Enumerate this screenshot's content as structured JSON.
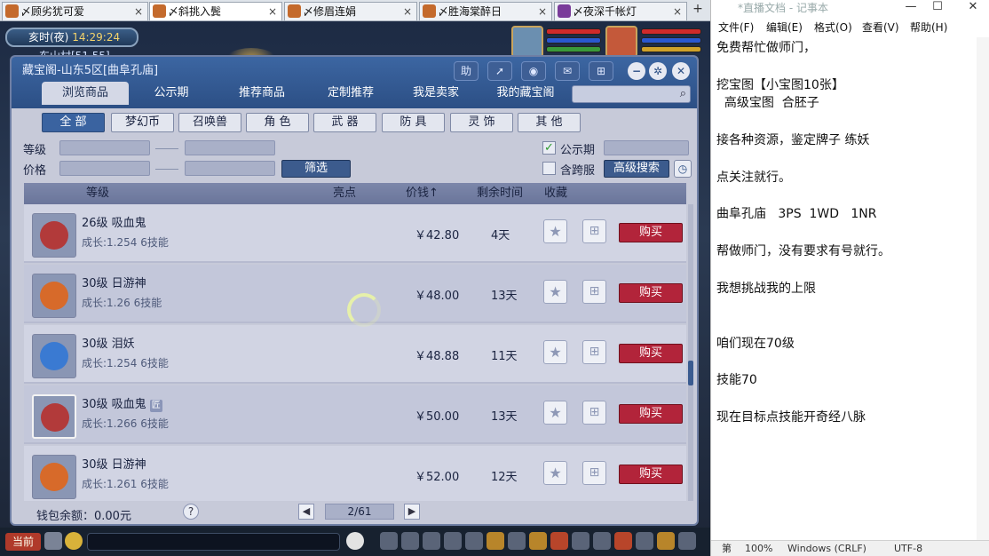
{
  "tabs": [
    {
      "label": "〆顾劣犹可爱"
    },
    {
      "label": "〆斜挑入鬓"
    },
    {
      "label": "〆修眉连娟"
    },
    {
      "label": "〆胜海棠醉日"
    },
    {
      "label": "〆夜深千帐灯"
    }
  ],
  "tab_close": "×",
  "tab_add": "+",
  "game": {
    "time_period": "亥时(夜)",
    "clock": "14:29:24",
    "map": "东山村[51,55]",
    "current_channel": "当前"
  },
  "dialog": {
    "title": "藏宝阁-山东5区[曲阜孔庙]",
    "help_btn": "助",
    "nav_tabs": [
      "浏览商品",
      "公示期",
      "推荐商品",
      "定制推荐",
      "我是卖家",
      "我的藏宝阁"
    ],
    "categories": [
      "全 部",
      "梦幻币",
      "召唤兽",
      "角 色",
      "武 器",
      "防 具",
      "灵 饰",
      "其 他"
    ],
    "filter": {
      "level_label": "等级",
      "price_label": "价格",
      "filter_btn": "筛选",
      "public_label": "公示期",
      "cross_label": "含跨服",
      "advanced_btn": "高级搜索"
    },
    "table_headers": {
      "level": "等级",
      "highlight": "亮点",
      "price": "价钱↑",
      "remaining": "剩余时间",
      "fav": "收藏"
    },
    "rows": [
      {
        "name": "26级 吸血鬼",
        "growth": "成长:1.254 6技能",
        "price": "￥42.80",
        "time": "4天",
        "buy": "购买",
        "badge": ""
      },
      {
        "name": "30级 日游神",
        "growth": "成长:1.26 6技能",
        "price": "￥48.00",
        "time": "13天",
        "buy": "购买",
        "badge": ""
      },
      {
        "name": "30级 泪妖",
        "growth": "成长:1.254 6技能",
        "price": "￥48.88",
        "time": "11天",
        "buy": "购买",
        "badge": ""
      },
      {
        "name": "30级 吸血鬼",
        "growth": "成长:1.266 6技能",
        "price": "￥50.00",
        "time": "13天",
        "buy": "购买",
        "badge": "匠"
      },
      {
        "name": "30级 日游神",
        "growth": "成长:1.261 6技能",
        "price": "￥52.00",
        "time": "12天",
        "buy": "购买",
        "badge": ""
      }
    ],
    "wallet": "钱包余额：0.00元",
    "help": "?",
    "page": "2/61"
  },
  "notepad": {
    "title": "*直播文档 - 记事本",
    "win_min": "—",
    "win_max": "☐",
    "win_close": "✕",
    "menu": [
      "文件(F)",
      "编辑(E)",
      "格式(O)",
      "查看(V)",
      "帮助(H)"
    ],
    "lines": [
      "免费帮忙做师门，",
      "",
      "挖宝图【小宝图10张】",
      "  高级宝图  合胚子",
      "",
      "接各种资源，鉴定牌子 练妖",
      "",
      "点关注就行。",
      "",
      "曲阜孔庙   3PS  1WD   1NR",
      "",
      "帮做师门，没有要求有号就行。",
      "",
      "我想挑战我的上限",
      "",
      "",
      "咱们现在70级",
      "",
      "技能70",
      "",
      "现在目标点技能开奇经八脉"
    ],
    "status": {
      "pos": "第",
      "zoom": "100%",
      "eol": "Windows (CRLF)",
      "enc": "UTF-8"
    }
  }
}
